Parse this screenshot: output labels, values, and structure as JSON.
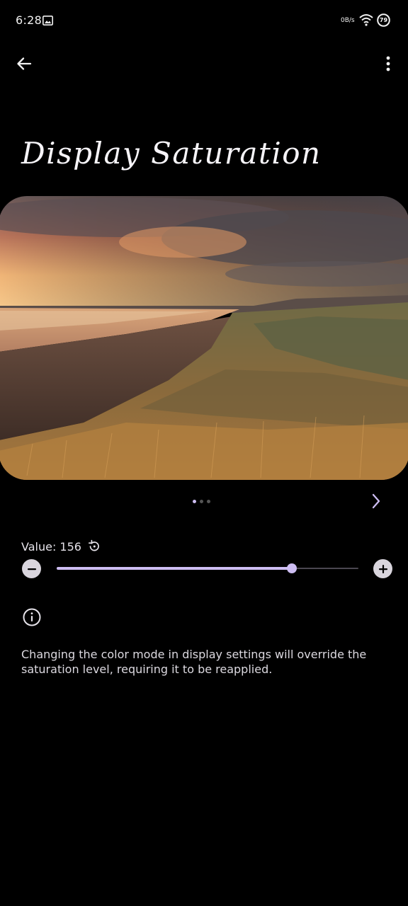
{
  "status_bar": {
    "time": "6:28",
    "net_speed": "0B/s",
    "battery": "79",
    "icons": [
      "gallery-icon",
      "wifi-icon",
      "battery-icon"
    ]
  },
  "app_bar": {
    "back_icon": "arrow-back-icon",
    "more_icon": "more-vert-icon"
  },
  "page": {
    "title": "Display Saturation"
  },
  "preview": {
    "pages_total": 3,
    "current_page": 1,
    "next_icon": "chevron-right-icon"
  },
  "saturation": {
    "value_label": "Value: 156",
    "value": 156,
    "fill_fraction": 0.78,
    "reset_icon": "reset-icon",
    "minus_icon": "minus-icon",
    "plus_icon": "plus-icon"
  },
  "info": {
    "icon": "info-icon",
    "text": "Changing the color mode in display settings will override the saturation level, requiring it to be reapplied."
  },
  "colors": {
    "accent": "#cdbdf2",
    "background": "#000000"
  }
}
